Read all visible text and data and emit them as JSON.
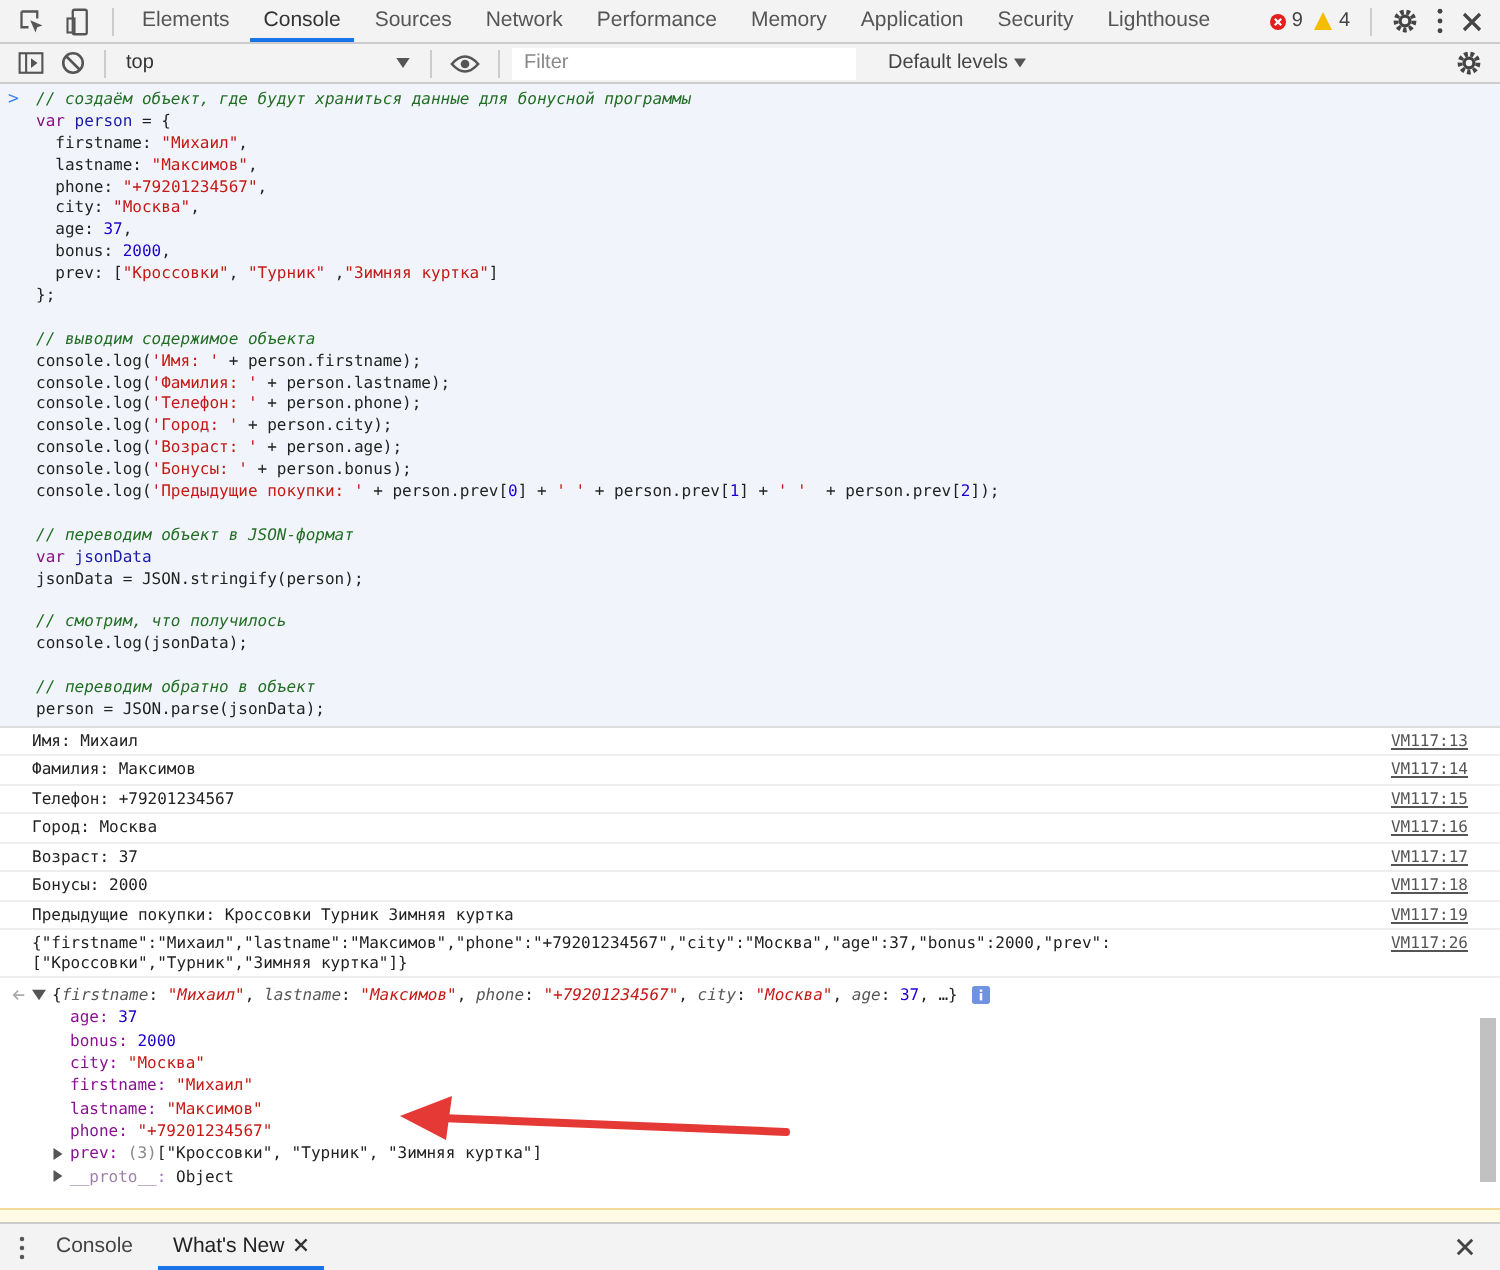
{
  "tabs": [
    {
      "label": "Elements",
      "selected": false
    },
    {
      "label": "Console",
      "selected": true
    },
    {
      "label": "Sources",
      "selected": false
    },
    {
      "label": "Network",
      "selected": false
    },
    {
      "label": "Performance",
      "selected": false
    },
    {
      "label": "Memory",
      "selected": false
    },
    {
      "label": "Application",
      "selected": false
    },
    {
      "label": "Security",
      "selected": false
    },
    {
      "label": "Lighthouse",
      "selected": false
    }
  ],
  "counts": {
    "errors": "9",
    "warnings": "4"
  },
  "toolbar": {
    "context": "top",
    "filter": {
      "placeholder": "Filter"
    },
    "levels": "Default levels"
  },
  "input": {
    "prompt": ">",
    "lines": [
      {
        "segments": [
          {
            "kind": "comment",
            "text": "// создаём объект, где будут храниться данные для бонусной программы"
          }
        ]
      },
      {
        "segments": [
          {
            "kind": "keyword",
            "text": "var "
          },
          {
            "kind": "variable",
            "text": "person"
          },
          {
            "kind": "plain",
            "text": " = {"
          }
        ]
      },
      {
        "segments": [
          {
            "kind": "plain",
            "text": "  firstname: "
          },
          {
            "kind": "string",
            "text": "\"Михаил\""
          },
          {
            "kind": "plain",
            "text": ","
          }
        ]
      },
      {
        "segments": [
          {
            "kind": "plain",
            "text": "  lastname: "
          },
          {
            "kind": "string",
            "text": "\"Максимов\""
          },
          {
            "kind": "plain",
            "text": ","
          }
        ]
      },
      {
        "segments": [
          {
            "kind": "plain",
            "text": "  phone: "
          },
          {
            "kind": "string",
            "text": "\"+79201234567\""
          },
          {
            "kind": "plain",
            "text": ","
          }
        ]
      },
      {
        "segments": [
          {
            "kind": "plain",
            "text": "  city: "
          },
          {
            "kind": "string",
            "text": "\"Москва\""
          },
          {
            "kind": "plain",
            "text": ","
          }
        ]
      },
      {
        "segments": [
          {
            "kind": "plain",
            "text": "  age: "
          },
          {
            "kind": "number",
            "text": "37"
          },
          {
            "kind": "plain",
            "text": ","
          }
        ]
      },
      {
        "segments": [
          {
            "kind": "plain",
            "text": "  bonus: "
          },
          {
            "kind": "number",
            "text": "2000"
          },
          {
            "kind": "plain",
            "text": ","
          }
        ]
      },
      {
        "segments": [
          {
            "kind": "plain",
            "text": "  prev: ["
          },
          {
            "kind": "string",
            "text": "\"Кроссовки\""
          },
          {
            "kind": "plain",
            "text": ", "
          },
          {
            "kind": "string",
            "text": "\"Турник\""
          },
          {
            "kind": "plain",
            "text": " ,"
          },
          {
            "kind": "string",
            "text": "\"Зимняя куртка\""
          },
          {
            "kind": "plain",
            "text": "]"
          }
        ]
      },
      {
        "segments": [
          {
            "kind": "plain",
            "text": "};"
          }
        ]
      },
      {
        "kind": "blank"
      },
      {
        "segments": [
          {
            "kind": "comment",
            "text": "// выводим содержимое объекта"
          }
        ]
      },
      {
        "segments": [
          {
            "kind": "plain",
            "text": "console.log("
          },
          {
            "kind": "string",
            "text": "'Имя: '"
          },
          {
            "kind": "plain",
            "text": " + person.firstname);"
          }
        ]
      },
      {
        "segments": [
          {
            "kind": "plain",
            "text": "console.log("
          },
          {
            "kind": "string",
            "text": "'Фамилия: '"
          },
          {
            "kind": "plain",
            "text": " + person.lastname);"
          }
        ]
      },
      {
        "segments": [
          {
            "kind": "plain",
            "text": "console.log("
          },
          {
            "kind": "string",
            "text": "'Телефон: '"
          },
          {
            "kind": "plain",
            "text": " + person.phone);"
          }
        ]
      },
      {
        "segments": [
          {
            "kind": "plain",
            "text": "console.log("
          },
          {
            "kind": "string",
            "text": "'Город: '"
          },
          {
            "kind": "plain",
            "text": " + person.city);"
          }
        ]
      },
      {
        "segments": [
          {
            "kind": "plain",
            "text": "console.log("
          },
          {
            "kind": "string",
            "text": "'Возраст: '"
          },
          {
            "kind": "plain",
            "text": " + person.age);"
          }
        ]
      },
      {
        "segments": [
          {
            "kind": "plain",
            "text": "console.log("
          },
          {
            "kind": "string",
            "text": "'Бонусы: '"
          },
          {
            "kind": "plain",
            "text": " + person.bonus);"
          }
        ]
      },
      {
        "segments": [
          {
            "kind": "plain",
            "text": "console.log("
          },
          {
            "kind": "string",
            "text": "'Предыдущие покупки: '"
          },
          {
            "kind": "plain",
            "text": " + person.prev["
          },
          {
            "kind": "number",
            "text": "0"
          },
          {
            "kind": "plain",
            "text": "] + "
          },
          {
            "kind": "string",
            "text": "' '"
          },
          {
            "kind": "plain",
            "text": " + person.prev["
          },
          {
            "kind": "number",
            "text": "1"
          },
          {
            "kind": "plain",
            "text": "] + "
          },
          {
            "kind": "string",
            "text": "' '"
          },
          {
            "kind": "plain",
            "text": "  + person.prev["
          },
          {
            "kind": "number",
            "text": "2"
          },
          {
            "kind": "plain",
            "text": "]);"
          }
        ]
      },
      {
        "kind": "blank"
      },
      {
        "segments": [
          {
            "kind": "comment",
            "text": "// переводим объект в JSON-формат"
          }
        ]
      },
      {
        "segments": [
          {
            "kind": "keyword",
            "text": "var "
          },
          {
            "kind": "variable",
            "text": "jsonData"
          }
        ]
      },
      {
        "segments": [
          {
            "kind": "plain",
            "text": "jsonData = JSON.stringify(person);"
          }
        ]
      },
      {
        "kind": "blank"
      },
      {
        "segments": [
          {
            "kind": "comment",
            "text": "// смотрим, что получилось"
          }
        ]
      },
      {
        "segments": [
          {
            "kind": "plain",
            "text": "console.log(jsonData);"
          }
        ]
      },
      {
        "kind": "blank"
      },
      {
        "segments": [
          {
            "kind": "comment",
            "text": "// переводим обратно в объект"
          }
        ]
      },
      {
        "segments": [
          {
            "kind": "plain",
            "text": "person = JSON.parse(jsonData);"
          }
        ]
      }
    ]
  },
  "logs": [
    {
      "lines": [
        "Имя: Михаил"
      ],
      "source": "VM117:13"
    },
    {
      "lines": [
        "Фамилия: Максимов"
      ],
      "source": "VM117:14"
    },
    {
      "lines": [
        "Телефон: +79201234567"
      ],
      "source": "VM117:15"
    },
    {
      "lines": [
        "Город: Москва"
      ],
      "source": "VM117:16"
    },
    {
      "lines": [
        "Возраст: 37"
      ],
      "source": "VM117:17"
    },
    {
      "lines": [
        "Бонусы: 2000"
      ],
      "source": "VM117:18"
    },
    {
      "lines": [
        "Предыдущие покупки: Кроссовки Турник Зимняя куртка"
      ],
      "source": "VM117:19"
    },
    {
      "lines": [
        "{\"firstname\":\"Михаил\",\"lastname\":\"Максимов\",\"phone\":\"+79201234567\",\"city\":\"Москва\",\"age\":37,\"bonus\":2000,\"prev\":",
        "[\"Кроссовки\",\"Турник\",\"Зимняя куртка\"]}"
      ],
      "source": "VM117:26"
    }
  ],
  "result": {
    "expanded": true,
    "summary": [
      {
        "kind": "punct",
        "text": "{"
      },
      {
        "kind": "key",
        "text": "firstname"
      },
      {
        "kind": "punct",
        "text": ": "
      },
      {
        "kind": "string",
        "text": "\"Михаил\""
      },
      {
        "kind": "punct",
        "text": ", "
      },
      {
        "kind": "key",
        "text": "lastname"
      },
      {
        "kind": "punct",
        "text": ": "
      },
      {
        "kind": "string",
        "text": "\"Максимов\""
      },
      {
        "kind": "punct",
        "text": ", "
      },
      {
        "kind": "key",
        "text": "phone"
      },
      {
        "kind": "punct",
        "text": ": "
      },
      {
        "kind": "string",
        "text": "\"+79201234567\""
      },
      {
        "kind": "punct",
        "text": ", "
      },
      {
        "kind": "key",
        "text": "city"
      },
      {
        "kind": "punct",
        "text": ": "
      },
      {
        "kind": "string",
        "text": "\"Москва\""
      },
      {
        "kind": "punct",
        "text": ", "
      },
      {
        "kind": "key",
        "text": "age"
      },
      {
        "kind": "punct",
        "text": ": "
      },
      {
        "kind": "number",
        "text": "37"
      },
      {
        "kind": "punct",
        "text": ", …}"
      }
    ],
    "properties": [
      {
        "key": "age:",
        "kind": "number",
        "value": "37"
      },
      {
        "key": "bonus:",
        "kind": "number",
        "value": "2000"
      },
      {
        "key": "city:",
        "kind": "string",
        "value": "\"Москва\""
      },
      {
        "key": "firstname:",
        "kind": "string",
        "value": "\"Михаил\""
      },
      {
        "key": "lastname:",
        "kind": "string",
        "value": "\"Максимов\""
      },
      {
        "key": "phone:",
        "kind": "string",
        "value": "\"+79201234567\""
      },
      {
        "key": "prev:",
        "kind": "array",
        "count": "(3)",
        "value": "[\"Кроссовки\", \"Турник\", \"Зимняя куртка\"]",
        "expanded": false
      },
      {
        "key": "__proto__:",
        "kind": "object",
        "value": "Object",
        "expanded": false
      }
    ]
  },
  "drawer": {
    "tabs": [
      {
        "label": "Console",
        "selected": false,
        "closable": false
      },
      {
        "label": "What's New",
        "selected": true,
        "closable": true
      }
    ]
  }
}
